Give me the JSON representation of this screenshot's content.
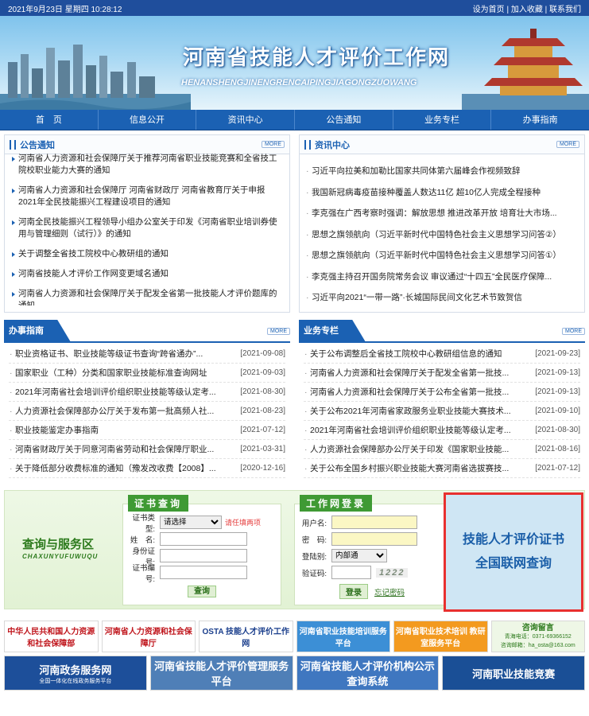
{
  "topbar": {
    "date": "2021年9月23日 星期四 10:28:12",
    "set_home": "设为首页",
    "add_fav": "加入收藏",
    "contact": "联系我们",
    "sep": "|"
  },
  "banner": {
    "title": "河南省技能人才评价工作网",
    "pinyin": "HENANSHENGJINENGRENCAIPINGJIAGONGZUOWANG"
  },
  "nav": [
    "首　页",
    "信息公开",
    "资讯中心",
    "公告通知",
    "业务专栏",
    "办事指南"
  ],
  "notice": {
    "title": "公告通知",
    "more": "MORE",
    "items": [
      "河南省人力资源和社会保障厅关于推荐河南省职业技能竞赛和全省技工院校职业能力大赛的通知",
      "河南省人力资源和社会保障厅 河南省财政厅 河南省教育厅关于申报2021年全民技能振兴工程建设项目的通知",
      "河南全民技能振兴工程领导小组办公室关于印发《河南省职业培训券使用与管理细则（试行）》的通知",
      "关于调整全省技工院校中心教研组的通知",
      "河南省技能人才评价工作网变更域名通知",
      "河南省人力资源和社会保障厅关于配发全省第一批技能人才评价题库的通知"
    ]
  },
  "news": {
    "title": "资讯中心",
    "more": "MORE",
    "items": [
      "习近平向拉美和加勒比国家共同体第六届峰会作视频致辞",
      "我国新冠病毒疫苗接种覆盖人数达11亿 超10亿人完成全程接种",
      "李克强在广西考察时强调：解放思想 推进改革开放 培育壮大市场...",
      "思想之旗领航向（习近平新时代中国特色社会主义思想学习问答②）",
      "思想之旗领航向（习近平新时代中国特色社会主义思想学习问答①）",
      "李克强主持召开国务院常务会议 审议通过“十四五”全民医疗保障...",
      "习近平向2021“一带一路”·长城国际民间文化艺术节致贺信"
    ]
  },
  "guide": {
    "title": "办事指南",
    "more": "MORE",
    "items": [
      {
        "t": "职业资格证书、职业技能等级证书查询“跨省通办”...",
        "d": "[2021-09-08]"
      },
      {
        "t": "国家职业（工种）分类和国家职业技能标准查询网址",
        "d": "[2021-09-03]"
      },
      {
        "t": "2021年河南省社会培训评价组织职业技能等级认定考...",
        "d": "[2021-08-30]"
      },
      {
        "t": "人力资源社会保障部办公厅关于发布第一批高频人社...",
        "d": "[2021-08-23]"
      },
      {
        "t": "职业技能鉴定办事指南",
        "d": "[2021-07-12]"
      },
      {
        "t": "河南省财政厅关于同意河南省劳动和社会保障厅职业...",
        "d": "[2021-03-31]"
      },
      {
        "t": "关于降低部分收费标准的通知（豫发改收费【2008】...",
        "d": "[2020-12-16]"
      }
    ]
  },
  "business": {
    "title": "业务专栏",
    "more": "MORE",
    "items": [
      {
        "t": "关于公布调整后全省技工院校中心教研组信息的通知",
        "d": "[2021-09-23]"
      },
      {
        "t": "河南省人力资源和社会保障厅关于配发全省第一批技...",
        "d": "[2021-09-13]"
      },
      {
        "t": "河南省人力资源和社会保障厅关于公布全省第一批技...",
        "d": "[2021-09-13]"
      },
      {
        "t": "关于公布2021年河南省家政服务业职业技能大赛技术...",
        "d": "[2021-09-10]"
      },
      {
        "t": "2021年河南省社会培训评价组织职业技能等级认定考...",
        "d": "[2021-08-30]"
      },
      {
        "t": "人力资源社会保障部办公厅关于印发《国家职业技能...",
        "d": "[2021-08-16]"
      },
      {
        "t": "关于公布全国乡村振兴职业技能大赛河南省选拔赛技...",
        "d": "[2021-07-12]"
      }
    ]
  },
  "service": {
    "title": "查询与服务区",
    "sub": "CHAXUNYUFUWUQU"
  },
  "cert_query": {
    "tab": "证书查询",
    "type_label": "证书类型:",
    "type_value": "请选择",
    "hint": "请任填两项",
    "name_label": "姓　名:",
    "id_label": "身份证号:",
    "no_label": "证书编号:",
    "btn": "查询"
  },
  "login": {
    "tab": "工作网登录",
    "user_label": "用户名:",
    "pwd_label": "密　码:",
    "cat_label": "登陆别:",
    "cat_value": "内部通",
    "code_label": "验证码:",
    "captcha": "1222",
    "login_btn": "登录",
    "forgot": "忘记密码"
  },
  "cert_banner": {
    "line1": "技能人才评价证书",
    "line2": "全国联网查询"
  },
  "links1": [
    {
      "label": "中华人民共和国人力资源和社会保障部",
      "bg": "#ffffff",
      "color": "#c0161d"
    },
    {
      "label": "河南省人力资源和社会保障厅",
      "bg": "#ffffff",
      "color": "#c0161d"
    },
    {
      "label": "OSTA 技能人才评价工作网",
      "bg": "#ffffff",
      "color": "#1a3e8c"
    },
    {
      "label": "河南省职业技能培训服务平台",
      "bg": "#3c8fd6",
      "color": "#ffffff"
    },
    {
      "label": "河南省职业技术培训 教研室服务平台",
      "bg": "#f39a1f",
      "color": "#ffffff"
    },
    {
      "label": "咨询留言",
      "bg": "#eef7e6",
      "color": "#2c7a1c"
    }
  ],
  "contact": {
    "phone": "青海电话：0371-69366152",
    "email": "咨询邮箱：ha_osta@163.com"
  },
  "links2": [
    {
      "label": "河南政务服务网",
      "sub": "全国一体化在线政务服务平台",
      "bg": "#1d4f9a",
      "color": "#ffffff"
    },
    {
      "label": "河南省技能人才评价管理服务平台",
      "sub": "",
      "bg": "#4f7fb7",
      "color": "#ffffff"
    },
    {
      "label": "河南省技能人才评价机构公示查询系统",
      "sub": "",
      "bg": "#3f77c0",
      "color": "#ffffff"
    },
    {
      "label": "河南职业技能竞赛",
      "sub": "",
      "bg": "#1a4f96",
      "color": "#ffffff"
    }
  ]
}
